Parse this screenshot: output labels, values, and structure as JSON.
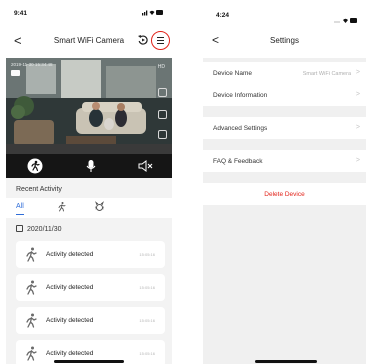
{
  "left_screen": {
    "status_bar": {
      "time": "9:41",
      "icons": "signal wifi battery"
    },
    "nav": {
      "back": "<",
      "title": "Smart WiFi Camera",
      "replay_icon": "replay-icon",
      "menu_icon": "menu-icon"
    },
    "camera": {
      "timestamp": "2019-11-30 15:34:48",
      "quality": "HD"
    },
    "controls": [
      "run-icon",
      "microphone-icon",
      "speaker-mute-icon"
    ],
    "recent_activity": {
      "title": "Recent Activity",
      "tabs": [
        "All"
      ],
      "date": "2020/11/30",
      "items": [
        {
          "label": "Activity detected",
          "time": "15:05:16"
        },
        {
          "label": "Activity detected",
          "time": "15:05:16"
        },
        {
          "label": "Activity detected",
          "time": "15:05:16"
        },
        {
          "label": "Activity detected",
          "time": "15:05:16"
        }
      ]
    }
  },
  "right_screen": {
    "status_bar": {
      "time": "4:24",
      "icons": "... wifi battery"
    },
    "nav": {
      "back": "<",
      "title": "Settings"
    },
    "rows": [
      {
        "label": "Device Name",
        "value": "Smart WiFi Camera"
      },
      {
        "label": "Device Information",
        "value": ""
      },
      {
        "label": "Advanced Settings",
        "value": ""
      },
      {
        "label": "FAQ & Feedback",
        "value": ""
      }
    ],
    "delete_label": "Delete Device",
    "chevron": ">"
  },
  "colors": {
    "accent_blue": "#2f6dd8",
    "highlight_red": "#e2231a",
    "delete_red": "#e2231a"
  }
}
